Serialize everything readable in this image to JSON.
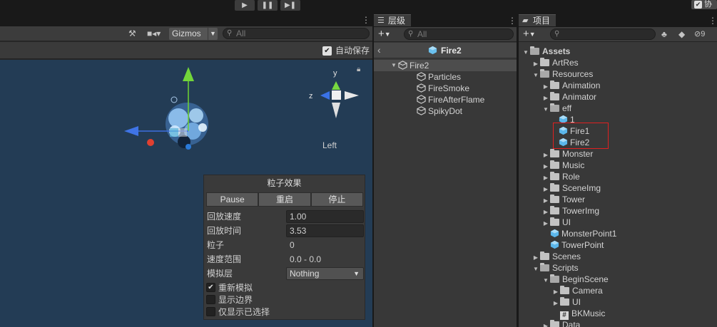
{
  "topbar": {
    "play": "▶",
    "pause": "❚❚",
    "step": "▶❚",
    "collab_label": "协"
  },
  "scene": {
    "gizmos_label": "Gizmos",
    "search_placeholder": "All",
    "autosave_label": "自动保存",
    "orientation_label": "Left",
    "axis_y": "y",
    "axis_z": "z"
  },
  "particle_effect": {
    "title": "粒子效果",
    "buttons": [
      "Pause",
      "重启",
      "停止"
    ],
    "playback_speed_label": "回放速度",
    "playback_speed": "1.00",
    "playback_time_label": "回放时间",
    "playback_time": "3.53",
    "particles_label": "粒子",
    "particles": "0",
    "speed_range_label": "速度范围",
    "speed_range": "0.0 - 0.0",
    "simulate_layers_label": "模拟层",
    "simulate_layers": "Nothing",
    "checks": [
      {
        "label": "重新模拟",
        "checked": true
      },
      {
        "label": "显示边界",
        "checked": false
      },
      {
        "label": "仅显示已选择",
        "checked": false
      }
    ]
  },
  "hierarchy": {
    "tab_label": "层级",
    "search_placeholder": "All",
    "prefab_name": "Fire2",
    "root": "Fire2",
    "children": [
      "Particles",
      "FireSmoke",
      "FireAfterFlame",
      "SpikyDot"
    ]
  },
  "project": {
    "tab_label": "项目",
    "hidden_count": "9",
    "tree": [
      {
        "label": "Assets",
        "depth": 0,
        "kind": "folder-open",
        "bold": true
      },
      {
        "label": "ArtRes",
        "depth": 1,
        "kind": "folder"
      },
      {
        "label": "Resources",
        "depth": 1,
        "kind": "folder-open"
      },
      {
        "label": "Animation",
        "depth": 2,
        "kind": "folder"
      },
      {
        "label": "Animator",
        "depth": 2,
        "kind": "folder"
      },
      {
        "label": "eff",
        "depth": 2,
        "kind": "folder-open"
      },
      {
        "label": "1",
        "depth": 3,
        "kind": "prefab"
      },
      {
        "label": "Fire1",
        "depth": 3,
        "kind": "prefab"
      },
      {
        "label": "Fire2",
        "depth": 3,
        "kind": "prefab"
      },
      {
        "label": "Monster",
        "depth": 2,
        "kind": "folder"
      },
      {
        "label": "Music",
        "depth": 2,
        "kind": "folder"
      },
      {
        "label": "Role",
        "depth": 2,
        "kind": "folder"
      },
      {
        "label": "SceneImg",
        "depth": 2,
        "kind": "folder"
      },
      {
        "label": "Tower",
        "depth": 2,
        "kind": "folder"
      },
      {
        "label": "TowerImg",
        "depth": 2,
        "kind": "folder"
      },
      {
        "label": "UI",
        "depth": 2,
        "kind": "folder"
      },
      {
        "label": "MonsterPoint1",
        "depth": 2,
        "kind": "prefab-leaf"
      },
      {
        "label": "TowerPoint",
        "depth": 2,
        "kind": "prefab-leaf"
      },
      {
        "label": "Scenes",
        "depth": 1,
        "kind": "folder"
      },
      {
        "label": "Scripts",
        "depth": 1,
        "kind": "folder-open"
      },
      {
        "label": "BeginScene",
        "depth": 2,
        "kind": "folder-open"
      },
      {
        "label": "Camera",
        "depth": 3,
        "kind": "folder"
      },
      {
        "label": "UI",
        "depth": 3,
        "kind": "folder"
      },
      {
        "label": "BKMusic",
        "depth": 3,
        "kind": "script"
      },
      {
        "label": "Data",
        "depth": 2,
        "kind": "folder"
      }
    ]
  }
}
